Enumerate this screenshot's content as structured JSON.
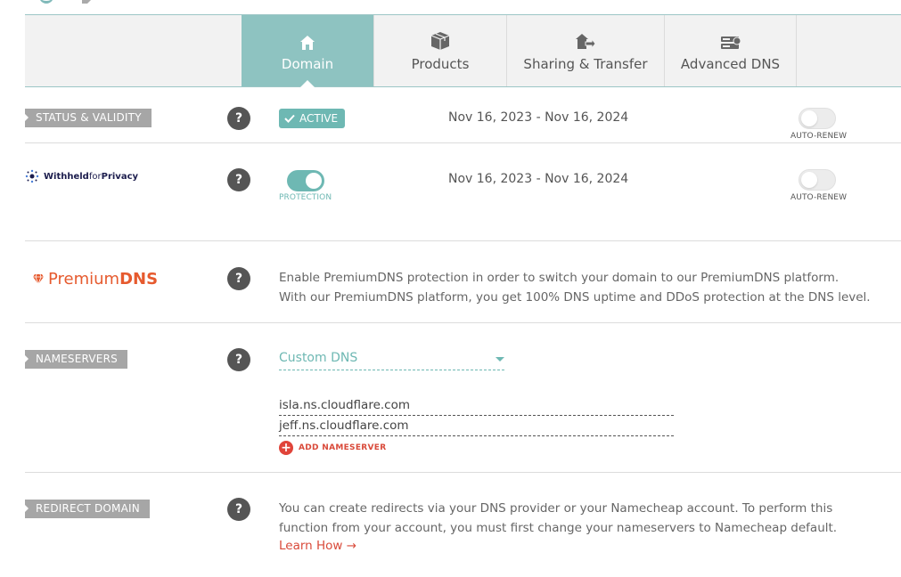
{
  "tabs": [
    {
      "label": "Domain",
      "icon": "home-icon",
      "active": true
    },
    {
      "label": "Products",
      "icon": "box-icon",
      "active": false
    },
    {
      "label": "Sharing & Transfer",
      "icon": "transfer-icon",
      "active": false
    },
    {
      "label": "Advanced DNS",
      "icon": "server-icon",
      "active": false
    }
  ],
  "status": {
    "label": "STATUS & VALIDITY",
    "help": "?",
    "badge": "ACTIVE",
    "dates": "Nov 16, 2023 - Nov 16, 2024",
    "autorenew_label": "AUTO-RENEW",
    "autorenew_on": false
  },
  "privacy": {
    "brand_bold": "Withheld",
    "brand_thin": "for",
    "brand_end": "Privacy",
    "help": "?",
    "protection_label": "PROTECTION",
    "protection_on": true,
    "dates": "Nov 16, 2023 - Nov 16, 2024",
    "autorenew_label": "AUTO-RENEW",
    "autorenew_on": false
  },
  "premiumdns": {
    "brand_thin": "Premium",
    "brand_bold": "DNS",
    "help": "?",
    "line1": "Enable PremiumDNS protection in order to switch your domain to our PremiumDNS platform.",
    "line2": "With our PremiumDNS platform, you get 100% DNS uptime and DDoS protection at the DNS level."
  },
  "nameservers": {
    "label": "NAMESERVERS",
    "help": "?",
    "selected": "Custom DNS",
    "servers": [
      "isla.ns.cloudflare.com",
      "jeff.ns.cloudflare.com"
    ],
    "add_label": "ADD NAMESERVER"
  },
  "redirect": {
    "label": "REDIRECT DOMAIN",
    "help": "?",
    "line1": "You can create redirects via your DNS provider or your Namecheap account. To perform this",
    "line2": "function from your account, you must first change your nameservers to Namecheap default.",
    "learn": "Learn How →"
  },
  "colors": {
    "teal": "#8ec3c1",
    "accent_red": "#d94a3a",
    "premium_orange": "#e65a2e",
    "label_gray": "#a6a6a6"
  }
}
